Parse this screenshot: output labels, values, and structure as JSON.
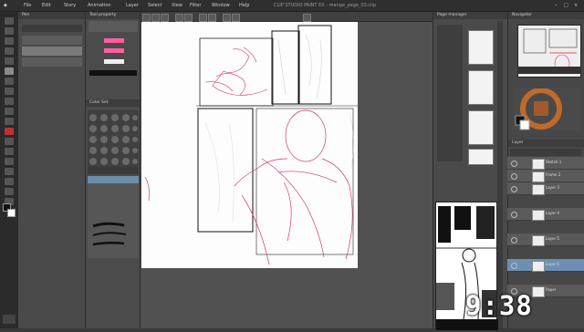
{
  "app": {
    "title": "CLIP STUDIO PAINT EX - manga_page_03.clip"
  },
  "menu": [
    "File",
    "Edit",
    "Story",
    "Animation",
    "Layer",
    "Select",
    "View",
    "Filter",
    "Window",
    "Help"
  ],
  "panels": {
    "subtool_title": "Pen",
    "toolprop_title": "Tool property",
    "color_set_title": "Color Set",
    "layer_title": "Layer",
    "page_manager_title": "Page manager",
    "navigator_title": "Navigator"
  },
  "layers": [
    {
      "name": "Sketch 1"
    },
    {
      "name": "Frame 2"
    },
    {
      "name": "Layer 3"
    },
    {
      "name": "Layer 4"
    },
    {
      "name": "Layer 5"
    },
    {
      "name": "Layer 6"
    },
    {
      "name": "Paper"
    }
  ],
  "colors": {
    "accent_pink": "#ff5fa0",
    "sketch_red": "#d2386a",
    "panel_bg": "#4a4a4a",
    "canvas_bg": "#515151"
  },
  "clock": "9:38"
}
